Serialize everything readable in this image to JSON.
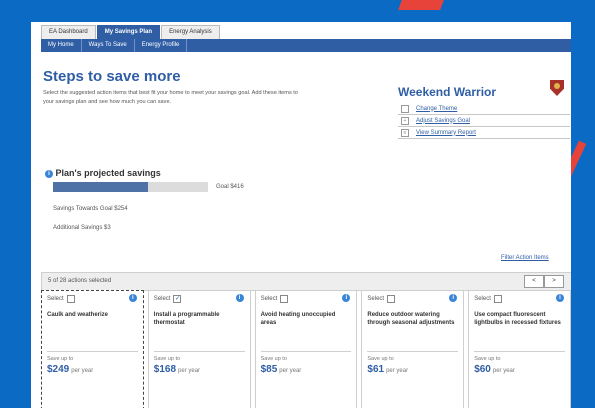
{
  "tabs": [
    "EA Dashboard",
    "My Savings Plan",
    "Energy Analysis"
  ],
  "subnav": [
    "My Home",
    "Ways To Save",
    "Energy Profile"
  ],
  "page": {
    "title": "Steps to save more",
    "intro": "Select the suggested action items that best fit your home to meet your savings goal. Add these items to your savings plan and see how much you can save."
  },
  "weekend": {
    "title": "Weekend Warrior",
    "links": [
      "Change Theme",
      "Adjust Savings Goal",
      "View Summary Report"
    ]
  },
  "plan": {
    "title": "Plan's projected savings",
    "goal": "Goal $416",
    "progress": 0.61,
    "toward": "Savings Towards Goal $254",
    "additional": "Additional Savings $3"
  },
  "actions": {
    "filter": "Filter Action Items",
    "count": "5 of 28 actions selected",
    "prev": "<",
    "next": ">"
  },
  "cards": [
    {
      "select": "Select",
      "checked": false,
      "title": "Caulk and weatherize",
      "save_label": "Save up to",
      "amount": "$249",
      "per": "per year"
    },
    {
      "select": "Select",
      "checked": true,
      "title": "Install a programmable thermostat",
      "save_label": "Save up to",
      "amount": "$168",
      "per": "per year"
    },
    {
      "select": "Select",
      "checked": false,
      "title": "Avoid heating unoccupied areas",
      "save_label": "Save up to",
      "amount": "$85",
      "per": "per year"
    },
    {
      "select": "Select",
      "checked": false,
      "title": "Reduce outdoor watering through seasonal adjustments",
      "save_label": "Save up to",
      "amount": "$61",
      "per": "per year"
    },
    {
      "select": "Select",
      "checked": false,
      "title": "Use compact fluorescent lightbulbs in recessed fixtures",
      "save_label": "Save up to",
      "amount": "$60",
      "per": "per year"
    }
  ],
  "colors": {
    "background": "#0a6ac4",
    "nav": "#2f5ea5",
    "accent_red": "#e8433a"
  }
}
